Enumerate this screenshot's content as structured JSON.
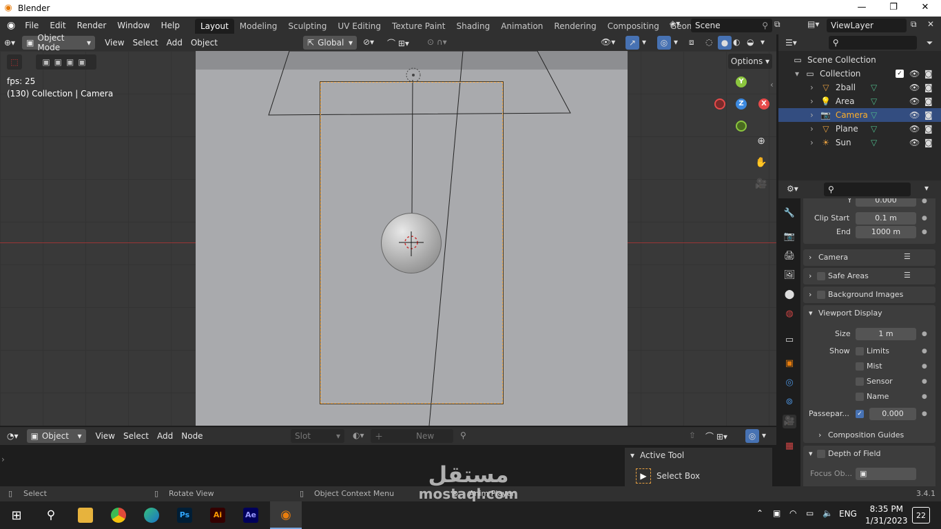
{
  "window": {
    "title": "Blender",
    "minimize": "—",
    "maximize": "❐",
    "close": "✕"
  },
  "topbar": {
    "menus": [
      "File",
      "Edit",
      "Render",
      "Window",
      "Help"
    ],
    "workspaces": [
      "Layout",
      "Modeling",
      "Sculpting",
      "UV Editing",
      "Texture Paint",
      "Shading",
      "Animation",
      "Rendering",
      "Compositing",
      "Geometry Node"
    ],
    "active_workspace": "Layout",
    "scene": "Scene",
    "view_layer": "ViewLayer"
  },
  "viewport_header": {
    "mode": "Object Mode",
    "menus": [
      "View",
      "Select",
      "Add",
      "Object"
    ],
    "transform": "Global",
    "options": "Options"
  },
  "viewport": {
    "fps": "fps: 25",
    "info": "(130) Collection | Camera",
    "gizmo": {
      "y": "Y",
      "x": "X",
      "z": "Z"
    },
    "colors": {
      "x": "#e74a4a",
      "y": "#8cc63f",
      "z": "#3d8ae0"
    }
  },
  "outliner": {
    "root": "Scene Collection",
    "collection": "Collection",
    "items": [
      {
        "name": "2ball",
        "icon": "▽",
        "selected": false
      },
      {
        "name": "Area",
        "icon": "💡",
        "selected": false
      },
      {
        "name": "Camera",
        "icon": "📷",
        "selected": true
      },
      {
        "name": "Plane",
        "icon": "▽",
        "selected": false
      },
      {
        "name": "Sun",
        "icon": "☀",
        "selected": false
      }
    ]
  },
  "properties": {
    "y_label": "Y",
    "y_value": "0.000",
    "clip_start_label": "Clip Start",
    "clip_start": "0.1 m",
    "clip_end_label": "End",
    "clip_end": "1000 m",
    "sections": [
      "Camera",
      "Safe Areas",
      "Background Images",
      "Viewport Display"
    ],
    "size_label": "Size",
    "size": "1 m",
    "show_label": "Show",
    "show_items": [
      "Limits",
      "Mist",
      "Sensor",
      "Name"
    ],
    "passepartout_label": "Passepar...",
    "passepartout": "0.000",
    "composition_guides": "Composition Guides",
    "dof": "Depth of Field",
    "focus_object": "Focus Ob..."
  },
  "shader_editor": {
    "type": "Object",
    "menus": [
      "View",
      "Select",
      "Add",
      "Node"
    ],
    "slot": "Slot",
    "new": "New"
  },
  "active_tool": {
    "title": "Active Tool",
    "tool": "Select Box"
  },
  "statusbar": {
    "select": "Select",
    "rotate": "Rotate View",
    "context": "Object Context Menu",
    "anim": "Anim Player",
    "version": "3.4.1"
  },
  "taskbar": {
    "apps": [
      "Ps",
      "Ai",
      "Ae"
    ],
    "lang": "ENG",
    "time": "8:35 PM",
    "date": "1/31/2023",
    "notifications": "22"
  },
  "watermark": {
    "arabic": "مستقل",
    "latin": "mostaql.com"
  }
}
